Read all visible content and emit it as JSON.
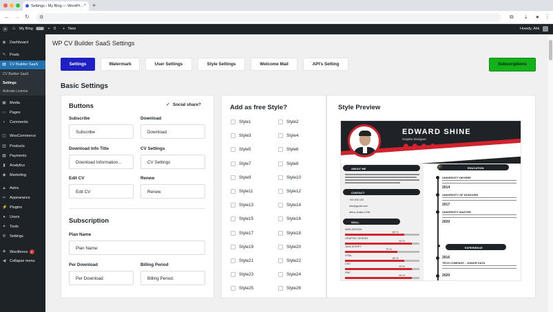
{
  "browser": {
    "tab_title": "Settings ‹ My Blog — WordPr...",
    "tab_close": "×",
    "new_tab": "+"
  },
  "adminbar": {
    "site_name": "My Blog",
    "live_badge": "Live",
    "comments_count": "0",
    "new_label": "New",
    "howdy": "Howdy, Atik"
  },
  "sidebar": {
    "items": [
      {
        "label": "Dashboard",
        "icon": "dashboard-icon"
      },
      {
        "label": "Posts",
        "icon": "pin-icon"
      },
      {
        "label": "CV Builder SaaS",
        "icon": "cv-icon"
      },
      {
        "label": "Media",
        "icon": "media-icon"
      },
      {
        "label": "Pages",
        "icon": "page-icon"
      },
      {
        "label": "Comments",
        "icon": "comment-icon"
      },
      {
        "label": "WooCommerce",
        "icon": "woo-icon"
      },
      {
        "label": "Products",
        "icon": "product-icon"
      },
      {
        "label": "Payments",
        "icon": "payment-icon"
      },
      {
        "label": "Analytics",
        "icon": "analytics-icon"
      },
      {
        "label": "Marketing",
        "icon": "marketing-icon"
      },
      {
        "label": "Astra",
        "icon": "astra-icon"
      },
      {
        "label": "Appearance",
        "icon": "brush-icon"
      },
      {
        "label": "Plugins",
        "icon": "plugin-icon"
      },
      {
        "label": "Users",
        "icon": "user-icon"
      },
      {
        "label": "Tools",
        "icon": "wrench-icon"
      },
      {
        "label": "Settings",
        "icon": "settings-icon"
      },
      {
        "label": "Wordfence",
        "icon": "shield-icon"
      },
      {
        "label": "Collapse menu",
        "icon": "collapse-icon"
      }
    ],
    "submenu": [
      "CV Builder SaaS",
      "Settings",
      "Activate License"
    ],
    "wordfence_badge": "2"
  },
  "page": {
    "title": "WP CV Builder SaaS Settings",
    "tabs": [
      "Settings",
      "Watermark",
      "User Settings",
      "Style Settings",
      "Welcome Mail",
      "API's Setting"
    ],
    "subscriptions_button": "Subscriptions",
    "section_heading": "Basic Settings"
  },
  "buttons_card": {
    "heading": "Buttons",
    "social_share": "Social share?",
    "fields": [
      {
        "label": "Subscribe",
        "value": "Subscribe"
      },
      {
        "label": "Download",
        "value": "Download"
      },
      {
        "label": "Download Info Title",
        "value": "Download Information..."
      },
      {
        "label": "CV Settings",
        "value": "CV Settings"
      },
      {
        "label": "Edit CV",
        "value": "Edit CV"
      },
      {
        "label": "Renew",
        "value": "Renew"
      }
    ]
  },
  "subscription_card": {
    "heading": "Subscription",
    "plan_name_label": "Plan Name",
    "plan_name_value": "Plan Name:",
    "per_download_label": "Per Download",
    "per_download_value": "Per Download:",
    "billing_period_label": "Billing Period",
    "billing_period_value": "Billing Period:"
  },
  "free_style": {
    "heading": "Add as free Style?",
    "styles": [
      "Style1",
      "Style2",
      "Style3",
      "Style4",
      "Style5",
      "Style6",
      "Style7",
      "Style8",
      "Style9",
      "Style10",
      "Style11",
      "Style12",
      "Style13",
      "Style14",
      "Style15",
      "Style16",
      "Style17",
      "Style18",
      "Style19",
      "Style20",
      "Style21",
      "Style22",
      "Style23",
      "Style24",
      "Style25",
      "Style26"
    ]
  },
  "preview": {
    "heading": "Style Preview",
    "cv_name": "EDWARD SHINE",
    "cv_job": "Graphic Designer",
    "about": "ABOUT ME",
    "contact": "CONTACT",
    "phone": "+00 000 100",
    "email": "info@gmail.com",
    "address": "africa dhaka 1236",
    "skill": "SKILL",
    "skills": [
      {
        "name": "WEB DESIGN",
        "pct": "80 %",
        "fill": 0.8
      },
      {
        "name": "GRAPHIC DESIGN",
        "pct": "90 %",
        "fill": 0.9
      },
      {
        "name": "JAVA SCRIPT",
        "pct": "70 %",
        "fill": 0.7
      },
      {
        "name": "HTML",
        "pct": "80 %",
        "fill": 0.8
      },
      {
        "name": "CSS",
        "pct": "90 %",
        "fill": 0.9
      },
      {
        "name": "PHP",
        "pct": "90 %",
        "fill": 0.9
      }
    ],
    "education": "EDUCATION",
    "edu": [
      {
        "title": "UNIVERSITY DEGREE",
        "year": "2014"
      },
      {
        "title": "UNIVERSITY OF HONOURS",
        "year": "2017"
      },
      {
        "title": "UNIVERSITY MASTER",
        "year": "2020"
      }
    ],
    "experience": "EXPERIENCE",
    "exp": [
      {
        "year": "2016",
        "title": "TECH COMPANY - JUNIOR DATA"
      },
      {
        "year": "2020",
        "title": ""
      }
    ]
  }
}
